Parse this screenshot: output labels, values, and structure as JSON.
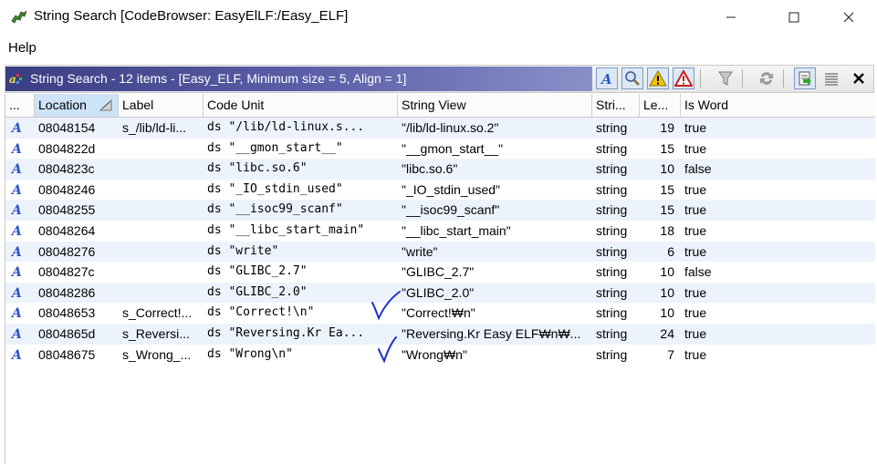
{
  "window": {
    "title": "String Search [CodeBrowser: EasyElLF:/Easy_ELF]",
    "minimize_icon": "minimize-icon",
    "maximize_icon": "maximize-icon",
    "close_icon": "close-icon"
  },
  "menu": {
    "help": "Help"
  },
  "panel": {
    "title": "String Search - 12 items - [Easy_ELF, Minimum size = 5, Align = 1]",
    "toolbar_icons": [
      "string-type-icon",
      "search-icon",
      "warning-icon",
      "error-warning-icon",
      "filter-icon",
      "refresh-icon",
      "make-string-icon",
      "list-view-icon",
      "close-icon"
    ]
  },
  "table": {
    "columns": [
      "...",
      "Location",
      "Label",
      "Code Unit",
      "String View",
      "Stri...",
      "Le...",
      "Is Word"
    ],
    "rows": [
      {
        "location": "08048154",
        "label": "s_/lib/ld-li...",
        "code_unit": "ds \"/lib/ld-linux.s...",
        "string_view": "\"/lib/ld-linux.so.2\"",
        "type": "string",
        "length": "19",
        "is_word": "true"
      },
      {
        "location": "0804822d",
        "label": "",
        "code_unit": "ds \"__gmon_start__\"",
        "string_view": "\"__gmon_start__\"",
        "type": "string",
        "length": "15",
        "is_word": "true"
      },
      {
        "location": "0804823c",
        "label": "",
        "code_unit": "ds \"libc.so.6\"",
        "string_view": "\"libc.so.6\"",
        "type": "string",
        "length": "10",
        "is_word": "false"
      },
      {
        "location": "08048246",
        "label": "",
        "code_unit": "ds \"_IO_stdin_used\"",
        "string_view": "\"_IO_stdin_used\"",
        "type": "string",
        "length": "15",
        "is_word": "true"
      },
      {
        "location": "08048255",
        "label": "",
        "code_unit": "ds \"__isoc99_scanf\"",
        "string_view": "\"__isoc99_scanf\"",
        "type": "string",
        "length": "15",
        "is_word": "true"
      },
      {
        "location": "08048264",
        "label": "",
        "code_unit": "ds \"__libc_start_main\"",
        "string_view": "\"__libc_start_main\"",
        "type": "string",
        "length": "18",
        "is_word": "true"
      },
      {
        "location": "08048276",
        "label": "",
        "code_unit": "ds \"write\"",
        "string_view": "\"write\"",
        "type": "string",
        "length": "6",
        "is_word": "true"
      },
      {
        "location": "0804827c",
        "label": "",
        "code_unit": "ds \"GLIBC_2.7\"",
        "string_view": "\"GLIBC_2.7\"",
        "type": "string",
        "length": "10",
        "is_word": "false"
      },
      {
        "location": "08048286",
        "label": "",
        "code_unit": "ds \"GLIBC_2.0\"",
        "string_view": "\"GLIBC_2.0\"",
        "type": "string",
        "length": "10",
        "is_word": "true"
      },
      {
        "location": "08048653",
        "label": "s_Correct!...",
        "code_unit": "ds \"Correct!\\n\"",
        "string_view": "\"Correct!₩n\"",
        "type": "string",
        "length": "10",
        "is_word": "true"
      },
      {
        "location": "0804865d",
        "label": "s_Reversi...",
        "code_unit": "ds \"Reversing.Kr Ea...",
        "string_view": "\"Reversing.Kr Easy ELF₩n₩...",
        "type": "string",
        "length": "24",
        "is_word": "true"
      },
      {
        "location": "08048675",
        "label": "s_Wrong_...",
        "code_unit": "ds \"Wrong\\n\"",
        "string_view": "\"Wrong₩n\"",
        "type": "string",
        "length": "7",
        "is_word": "true"
      }
    ]
  },
  "colors": {
    "title_gradient_start": "#3a3d82",
    "alt_row": "#edf3fc",
    "sorted_header": "#cde3f7",
    "annotation_check": "#1a2fd0"
  }
}
